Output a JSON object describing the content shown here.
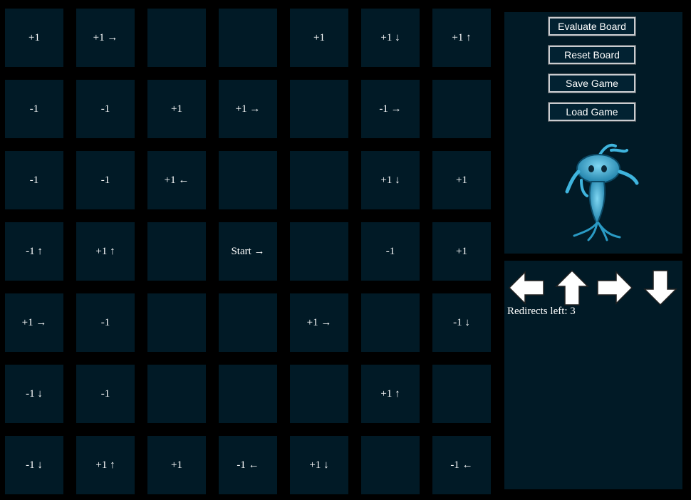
{
  "board": {
    "cells": [
      [
        "+1",
        "+1 →",
        "",
        "",
        "+1",
        "+1 ↓",
        "+1 ↑"
      ],
      [
        "-1",
        "-1",
        "+1",
        "+1 →",
        "",
        "-1 →",
        ""
      ],
      [
        "-1",
        "-1",
        "+1 ←",
        "",
        "",
        "+1 ↓",
        "+1"
      ],
      [
        "-1 ↑",
        "+1 ↑",
        "",
        "Start →",
        "",
        "-1",
        "+1"
      ],
      [
        "+1 →",
        "-1",
        "",
        "",
        "+1 →",
        "",
        "-1 ↓"
      ],
      [
        "-1 ↓",
        "-1",
        "",
        "",
        "",
        "+1 ↑",
        ""
      ],
      [
        "-1 ↓",
        "+1 ↑",
        "+1",
        "-1 ←",
        "+1 ↓",
        "",
        "-1 ←"
      ]
    ]
  },
  "controls": {
    "evaluate_label": "Evaluate Board",
    "reset_label": "Reset Board",
    "save_label": "Save Game",
    "load_label": "Load Game"
  },
  "redirects": {
    "arrows": [
      "left-arrow-icon",
      "up-arrow-icon",
      "right-arrow-icon",
      "down-arrow-icon"
    ],
    "text": "Redirects left: 3"
  },
  "colors": {
    "page_background": "#000000",
    "cell_background": "#011a26",
    "text": "#ffffff",
    "mascot": "#3fb4dd"
  }
}
